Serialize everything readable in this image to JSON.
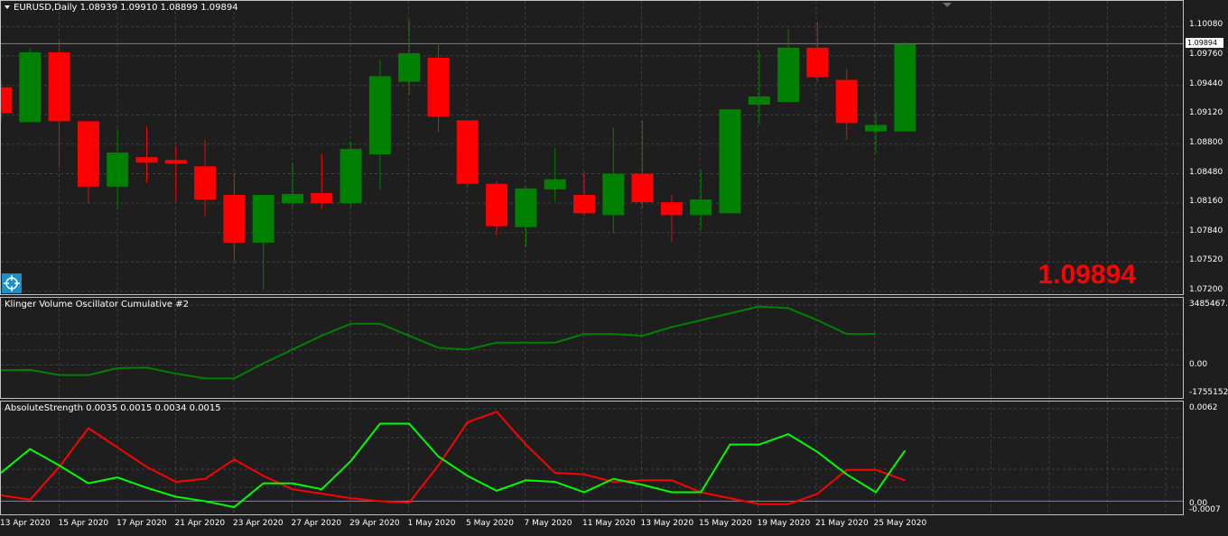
{
  "main_chart": {
    "symbol_line": "EURUSD,Daily  1.08939 1.09910 1.08899 1.09894",
    "big_price": "1.09894",
    "current_price_box": "1.09894",
    "price_axis": [
      "1.10080",
      "1.09760",
      "1.09440",
      "1.09120",
      "1.08800",
      "1.08480",
      "1.08160",
      "1.07840",
      "1.07520",
      "1.07200"
    ],
    "colors": {
      "bull": "#008000",
      "bear": "#ff0000",
      "background": "#1e1e1e",
      "grid": "#404040",
      "big_price": "#ff0000"
    },
    "candles": [
      {
        "date": "10 Apr 2020",
        "open": 1.0942,
        "high": 1.095,
        "low": 1.0905,
        "close": 1.0914
      },
      {
        "date": "13 Apr 2020",
        "open": 1.0904,
        "high": 1.0985,
        "low": 1.0904,
        "close": 1.098
      },
      {
        "date": "14 Apr 2020",
        "open": 1.098,
        "high": 1.0993,
        "low": 1.0855,
        "close": 1.0905
      },
      {
        "date": "15 Apr 2020",
        "open": 1.0905,
        "high": 1.0905,
        "low": 1.0816,
        "close": 1.0834
      },
      {
        "date": "16 Apr 2020",
        "open": 1.0834,
        "high": 1.0896,
        "low": 1.0809,
        "close": 1.0871
      },
      {
        "date": "17 Apr 2020",
        "open": 1.0866,
        "high": 1.0899,
        "low": 1.0838,
        "close": 1.086
      },
      {
        "date": "20 Apr 2020",
        "open": 1.0863,
        "high": 1.0878,
        "low": 1.0818,
        "close": 1.0859
      },
      {
        "date": "21 Apr 2020",
        "open": 1.0856,
        "high": 1.0885,
        "low": 1.0802,
        "close": 1.082
      },
      {
        "date": "22 Apr 2020",
        "open": 1.0825,
        "high": 1.0849,
        "low": 1.0752,
        "close": 1.0773
      },
      {
        "date": "23 Apr 2020",
        "open": 1.0773,
        "high": 1.0825,
        "low": 1.0722,
        "close": 1.0825
      },
      {
        "date": "24 Apr 2020",
        "open": 1.0816,
        "high": 1.086,
        "low": 1.0812,
        "close": 1.0826
      },
      {
        "date": "27 Apr 2020",
        "open": 1.0827,
        "high": 1.087,
        "low": 1.081,
        "close": 1.0816
      },
      {
        "date": "28 Apr 2020",
        "open": 1.0816,
        "high": 1.0883,
        "low": 1.0812,
        "close": 1.0875
      },
      {
        "date": "29 Apr 2020",
        "open": 1.0869,
        "high": 1.0972,
        "low": 1.0831,
        "close": 1.0954
      },
      {
        "date": "30 Apr 2020",
        "open": 1.0948,
        "high": 1.1015,
        "low": 1.0934,
        "close": 1.0979
      },
      {
        "date": "1 May 2020",
        "open": 1.0974,
        "high": 1.099,
        "low": 1.0893,
        "close": 1.091
      },
      {
        "date": "4 May 2020",
        "open": 1.0906,
        "high": 1.0906,
        "low": 1.0834,
        "close": 1.0837
      },
      {
        "date": "5 May 2020",
        "open": 1.0837,
        "high": 1.084,
        "low": 1.0781,
        "close": 1.0791
      },
      {
        "date": "6 May 2020",
        "open": 1.079,
        "high": 1.0834,
        "low": 1.0768,
        "close": 1.0832
      },
      {
        "date": "7 May 2020",
        "open": 1.0831,
        "high": 1.0876,
        "low": 1.0818,
        "close": 1.0842
      },
      {
        "date": "8 May 2020",
        "open": 1.0825,
        "high": 1.085,
        "low": 1.0802,
        "close": 1.0805
      },
      {
        "date": "11 May 2020",
        "open": 1.0803,
        "high": 1.0898,
        "low": 1.0783,
        "close": 1.0848
      },
      {
        "date": "12 May 2020",
        "open": 1.0848,
        "high": 1.0906,
        "low": 1.0811,
        "close": 1.0817
      },
      {
        "date": "13 May 2020",
        "open": 1.0817,
        "high": 1.0825,
        "low": 1.0774,
        "close": 1.0803
      },
      {
        "date": "14 May 2020",
        "open": 1.0803,
        "high": 1.0852,
        "low": 1.0787,
        "close": 1.082
      },
      {
        "date": "15 May 2020",
        "open": 1.0805,
        "high": 1.0918,
        "low": 1.0805,
        "close": 1.0918
      },
      {
        "date": "18 May 2020",
        "open": 1.0923,
        "high": 1.0981,
        "low": 1.0902,
        "close": 1.0932
      },
      {
        "date": "19 May 2020",
        "open": 1.0926,
        "high": 1.1005,
        "low": 1.0926,
        "close": 1.0985
      },
      {
        "date": "20 May 2020",
        "open": 1.0985,
        "high": 1.1013,
        "low": 1.0948,
        "close": 1.0953
      },
      {
        "date": "21 May 2020",
        "open": 1.095,
        "high": 1.0962,
        "low": 1.0885,
        "close": 1.0903
      },
      {
        "date": "22 May 2020",
        "open": 1.0894,
        "high": 1.0915,
        "low": 1.087,
        "close": 1.0901
      },
      {
        "date": "25 May 2020",
        "open": 1.0894,
        "high": 1.0991,
        "low": 1.0894,
        "close": 1.0989
      }
    ],
    "ylim": [
      1.072,
      1.1028
    ]
  },
  "klinger": {
    "title": "Klinger Volume Oscillator Cumulative #2",
    "axis_top": "3485467.1",
    "axis_zero": "0.00",
    "axis_bottom": "-1755152.0",
    "line_color": "#008000",
    "values": [
      -300000,
      -280000,
      -580000,
      -580000,
      -180000,
      -150000,
      -500000,
      -780000,
      -780000,
      100000,
      900000,
      1700000,
      2400000,
      2400000,
      1700000,
      1000000,
      900000,
      1300000,
      1300000,
      1300000,
      1800000,
      1800000,
      1700000,
      2200000,
      2600000,
      3000000,
      3400000,
      3300000,
      2600000,
      1800000,
      1800000
    ],
    "ylim": [
      -1755152.0,
      3485467.1
    ]
  },
  "absolute_strength": {
    "title": "AbsoluteStrength 0.0035 0.0015 0.0034 0.0015",
    "axis_top": "0.0062",
    "axis_zero": "0.00",
    "axis_bottom": "-0.0007",
    "series": [
      {
        "color": "#ff0000",
        "values": [
          0.0004,
          0.0001,
          0.0023,
          0.0049,
          0.0036,
          0.0023,
          0.0013,
          0.0015,
          0.0028,
          0.0017,
          0.0008,
          0.0005,
          0.0002,
          0.0,
          -0.0001,
          0.0024,
          0.0053,
          0.006,
          0.0038,
          0.0019,
          0.0018,
          0.0013,
          0.0014,
          0.0014,
          0.0006,
          0.0002,
          -0.0002,
          -0.0002,
          0.0005,
          0.0021,
          0.0021,
          0.0014
        ]
      },
      {
        "color": "#00ff00",
        "values": [
          0.0019,
          0.0035,
          0.0024,
          0.0012,
          0.0016,
          0.0009,
          0.0003,
          0.0,
          -0.0004,
          0.0012,
          0.0012,
          0.0008,
          0.0027,
          0.0052,
          0.0052,
          0.003,
          0.0017,
          0.0007,
          0.0014,
          0.0013,
          0.0006,
          0.0015,
          0.0011,
          0.0006,
          0.0006,
          0.0038,
          0.0038,
          0.0045,
          0.0033,
          0.0018,
          0.0006,
          0.0034
        ]
      }
    ],
    "zero_line_color": "#9370db",
    "ylim": [
      -0.0007,
      0.0062
    ]
  },
  "date_axis": [
    "13 Apr 2020",
    "15 Apr 2020",
    "17 Apr 2020",
    "21 Apr 2020",
    "23 Apr 2020",
    "27 Apr 2020",
    "29 Apr 2020",
    "1 May 2020",
    "5 May 2020",
    "7 May 2020",
    "11 May 2020",
    "13 May 2020",
    "15 May 2020",
    "19 May 2020",
    "21 May 2020",
    "25 May 2020"
  ]
}
